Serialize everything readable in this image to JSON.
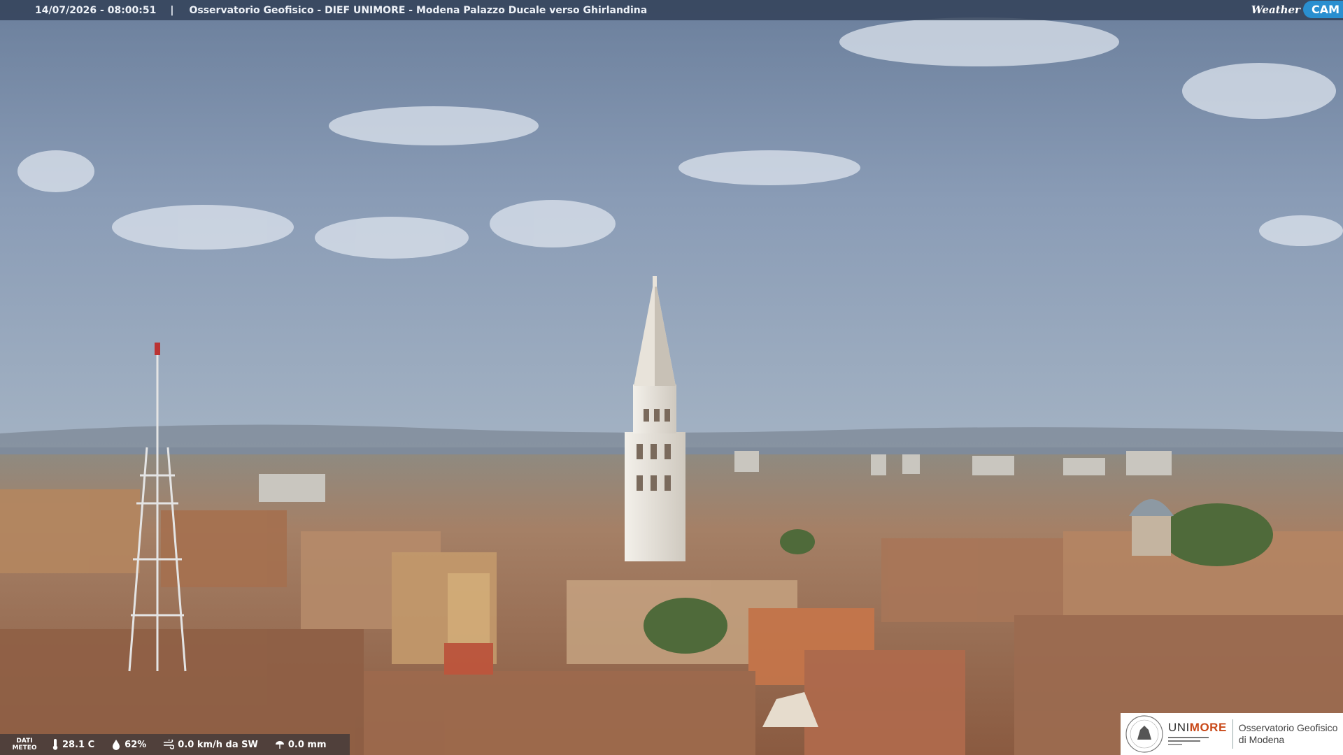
{
  "header": {
    "timestamp": "14/07/2026 - 08:00:51",
    "separator": "|",
    "station": "Osservatorio Geofisico - DIEF UNIMORE - Modena Palazzo Ducale verso Ghirlandina",
    "brand_weather": "Weather",
    "brand_cam": "CAM"
  },
  "weather": {
    "label_line1": "DATI",
    "label_line2": "METEO",
    "temperature": "28.1 C",
    "humidity": "62%",
    "wind": "0.0 km/h da SW",
    "rain": "0.0 mm",
    "icons": [
      "thermometer-icon",
      "humidity-drop-icon",
      "wind-icon",
      "rain-icon"
    ]
  },
  "logo": {
    "uni_prefix": "UNI",
    "uni_suffix": "MORE",
    "observatory_line1": "Osservatorio Geofisico",
    "observatory_line2": "di Modena",
    "brand_color": "#c94a1a"
  },
  "colors": {
    "sky_top": "#6b7f9c",
    "sky_bottom": "#9fb0c6",
    "roofs": "#a06a4c",
    "tower": "#ece8e0",
    "brand_blue": "#2a8fd0"
  }
}
